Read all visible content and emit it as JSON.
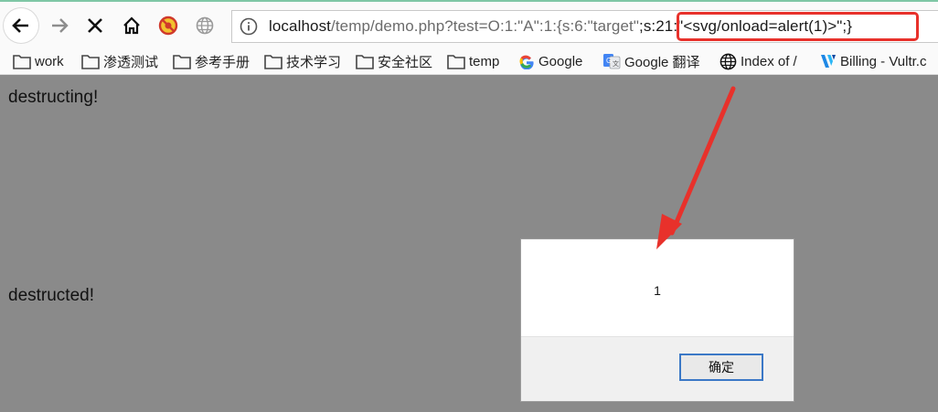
{
  "browser": {
    "address": {
      "host": "localhost",
      "path_before_highlight": "/temp/demo.php?test=O:1:\"A\":1:{s:6:\"target\"",
      "highlighted": ";s:21:\"<svg/onload=alert(1)>\";}"
    },
    "nav_icons": [
      "back-arrow-icon",
      "forward-arrow-icon",
      "stop-icon",
      "home-icon",
      "extension-icon",
      "globe-icon"
    ],
    "bookmarks": [
      {
        "label": "work",
        "icon": "folder-icon"
      },
      {
        "label": "渗透测试",
        "icon": "folder-icon"
      },
      {
        "label": "参考手册",
        "icon": "folder-icon"
      },
      {
        "label": "技术学习",
        "icon": "folder-icon"
      },
      {
        "label": "安全社区",
        "icon": "folder-icon"
      },
      {
        "label": "temp",
        "icon": "folder-icon"
      },
      {
        "label": "Google",
        "icon": "google-icon"
      },
      {
        "label": "Google 翻译",
        "icon": "google-translate-icon"
      },
      {
        "label": "Index of /",
        "icon": "globe-icon"
      },
      {
        "label": "Billing - Vultr.c",
        "icon": "vultr-icon"
      }
    ]
  },
  "page": {
    "line1": "destructing!",
    "line2": "destructed!"
  },
  "alert_dialog": {
    "message": "1",
    "ok_label": "确定"
  },
  "colors": {
    "page_bg": "#8a8a8a",
    "annotation_red": "#e8312b",
    "button_focus": "#3b78c6"
  }
}
